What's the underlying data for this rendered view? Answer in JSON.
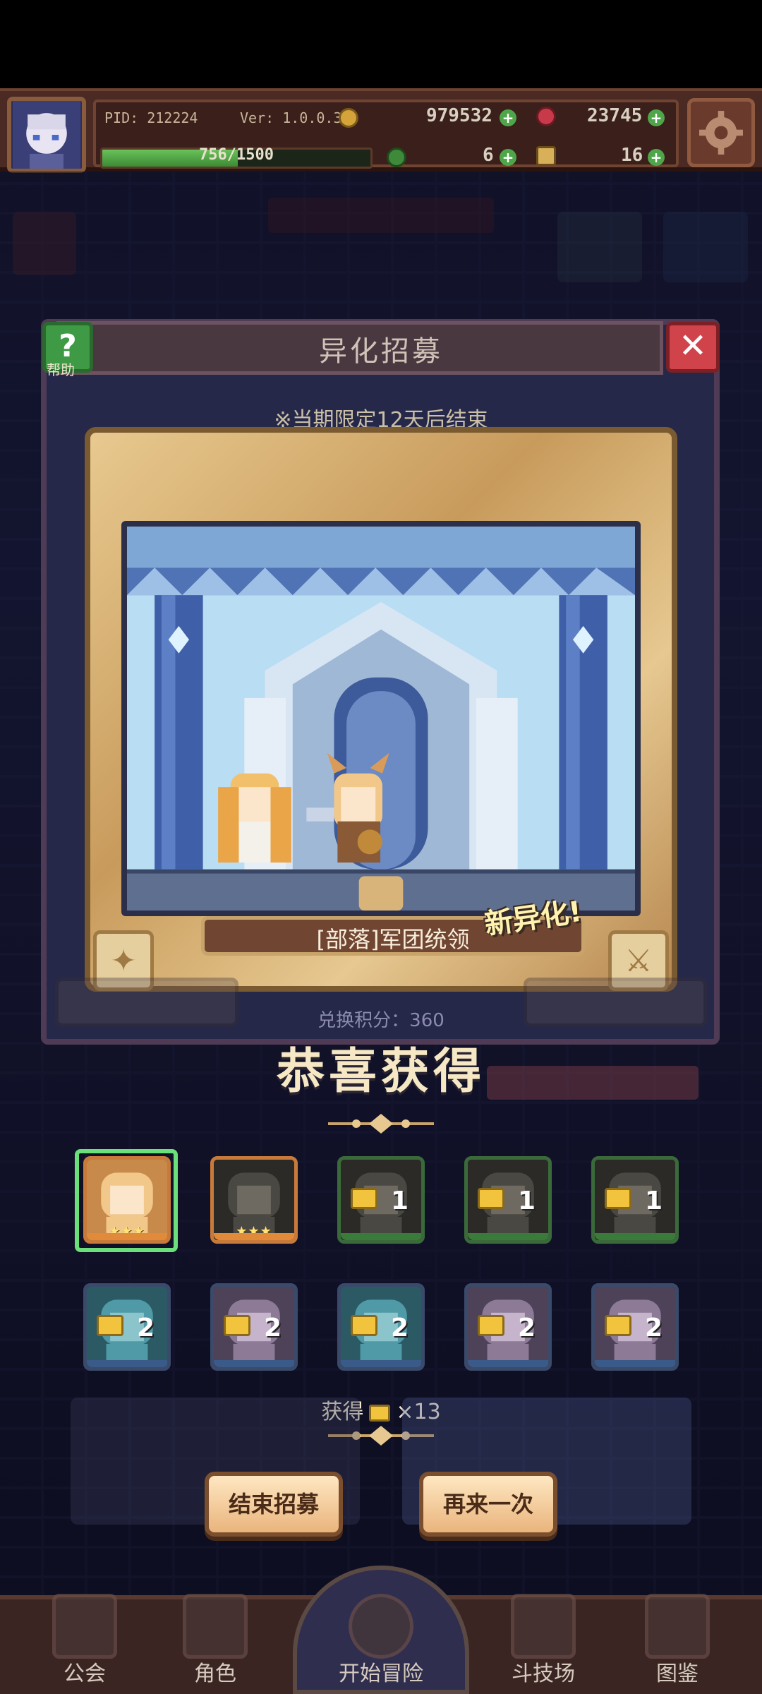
{
  "hud": {
    "pid": "PID: 212224",
    "version": "Ver: 1.0.0.3",
    "gold": "979532",
    "gems": "23745",
    "exp": "756/1500",
    "exp_fraction": 0.504,
    "clover": "6",
    "item": "16"
  },
  "dialog": {
    "title": "异化招募",
    "help_label": "帮助",
    "limited_notice": "※当期限定12天后结束",
    "character_name": "[部落]军团统领",
    "new_badge": "新异化!",
    "points": "兑换积分：360"
  },
  "result": {
    "congrats": "恭喜获得",
    "rewards": [
      {
        "type": "character",
        "stars": "★★★",
        "theme": "blonde",
        "selected": true
      },
      {
        "type": "character",
        "stars": "★★★",
        "theme": "dark",
        "selected": false
      },
      {
        "type": "fragment",
        "qty": "1",
        "theme": "dark"
      },
      {
        "type": "fragment",
        "qty": "1",
        "theme": "dark"
      },
      {
        "type": "fragment",
        "qty": "1",
        "theme": "dark"
      },
      {
        "type": "fragment",
        "qty": "2",
        "theme": "teal"
      },
      {
        "type": "fragment",
        "qty": "2",
        "theme": "pink"
      },
      {
        "type": "fragment",
        "qty": "2",
        "theme": "teal"
      },
      {
        "type": "fragment",
        "qty": "2",
        "theme": "pink"
      },
      {
        "type": "fragment",
        "qty": "2",
        "theme": "pink"
      }
    ],
    "summary_prefix": "获得",
    "summary_count": "×13",
    "end_button": "结束招募",
    "again_button": "再来一次"
  },
  "nav": {
    "guild": "公会",
    "character": "角色",
    "adventure": "开始冒险",
    "arena": "斗技场",
    "codex": "图鉴"
  },
  "colors": {
    "accent_gold": "#e6c890",
    "select_green": "#6be07a",
    "button_cream": "#ffe7c2"
  }
}
